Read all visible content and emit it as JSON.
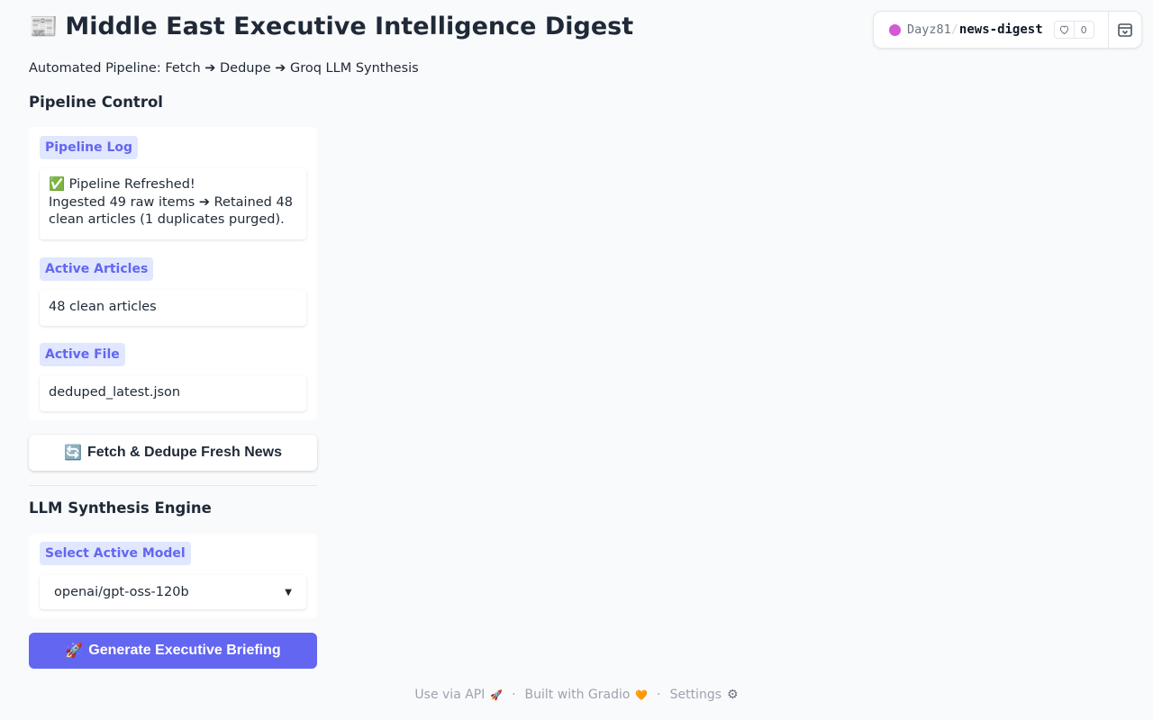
{
  "header": {
    "icon": "newspaper-icon",
    "icon_glyph": "📰",
    "title": "Middle East Executive Intelligence Digest",
    "subtitle": "Automated Pipeline: Fetch ➔ Dedupe ➔ Groq LLM Synthesis"
  },
  "space_badge": {
    "owner": "Dayz81",
    "separator": "/",
    "repo": "news-digest",
    "likes": "0",
    "avatar_color": "#d15ad6"
  },
  "pipeline_control": {
    "heading": "Pipeline Control",
    "log_label": "Pipeline Log",
    "log_line1": "✅ Pipeline Refreshed!",
    "log_line2": "Ingested 49 raw items ➔ Retained 48 clean articles (1 duplicates purged).",
    "articles_label": "Active Articles",
    "articles_value": "48 clean articles",
    "file_label": "Active File",
    "file_value": "deduped_latest.json",
    "refresh_button": "Fetch & Dedupe Fresh News",
    "refresh_glyph": "🔄"
  },
  "llm_engine": {
    "heading": "LLM Synthesis Engine",
    "model_label": "Select Active Model",
    "model_value": "openai/gpt-oss-120b",
    "generate_button": "Generate Executive Briefing",
    "generate_glyph": "🚀"
  },
  "footer": {
    "api_label": "Use via API",
    "api_glyph": "🚀",
    "built_label": "Built with Gradio",
    "built_glyph": "🧡",
    "settings_label": "Settings",
    "settings_glyph": "⚙",
    "separator": "·"
  },
  "colors": {
    "accent": "#6366f1",
    "chip_bg": "#e0e7ff",
    "background": "#f9fafb"
  }
}
